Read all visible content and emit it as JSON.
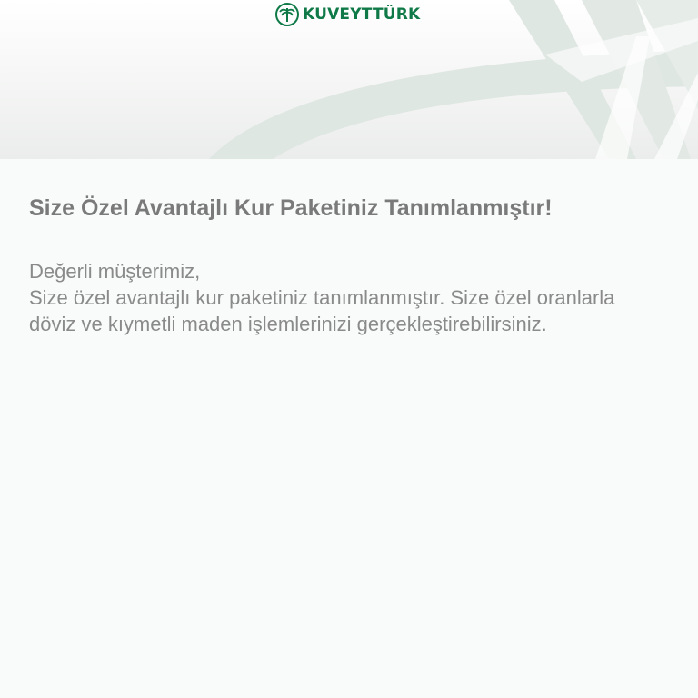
{
  "header": {
    "brand": "KUVEYTTÜRK",
    "colors": {
      "brand": "#0f7a47",
      "decor": "#dde6e1"
    }
  },
  "notification": {
    "title": "Size Özel Avantajlı Kur Paketiniz Tanımlanmıştır!",
    "greeting": "Değerli müşterimiz,",
    "message": "Size özel avantajlı kur paketiniz tanımlanmıştır. Size özel oranlarla döviz ve kıymetli maden işlemlerinizi gerçekleştirebilirsiniz."
  },
  "colors": {
    "title": "#7a7a7a",
    "text": "#8a8a8a",
    "background": "#f8fbfa"
  }
}
